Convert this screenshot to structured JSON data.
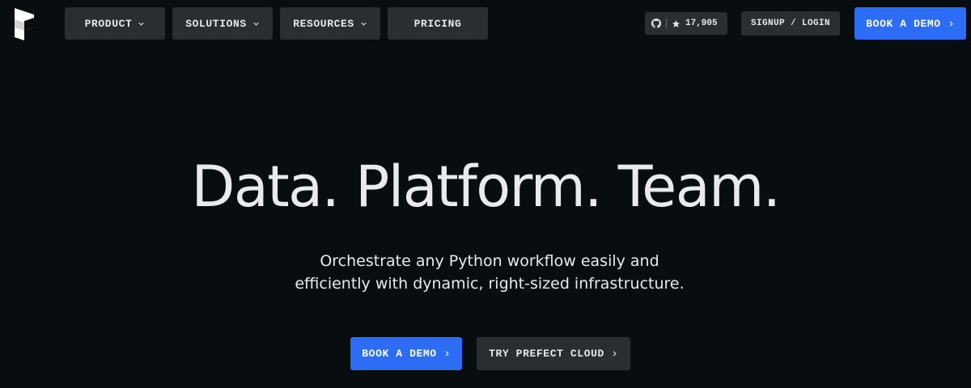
{
  "header": {
    "logo_icon": "prefect-logo-icon",
    "nav": [
      {
        "label": "PRODUCT",
        "has_dropdown": true
      },
      {
        "label": "SOLUTIONS",
        "has_dropdown": true
      },
      {
        "label": "RESOURCES",
        "has_dropdown": true
      },
      {
        "label": "PRICING",
        "has_dropdown": false
      }
    ],
    "github": {
      "icon": "github-icon",
      "star_icon": "star-icon",
      "stars": "17,905"
    },
    "signup_label": "SIGNUP / LOGIN",
    "book_demo_label": "BOOK A DEMO"
  },
  "hero": {
    "title": "Data. Platform. Team.",
    "subtitle_line1": "Orchestrate any Python workflow easily and",
    "subtitle_line2": "efficiently with dynamic, right-sized infrastructure.",
    "cta_primary": "BOOK A DEMO",
    "cta_secondary": "TRY PREFECT CLOUD"
  },
  "colors": {
    "background": "#080d10",
    "button_dark": "#2a2e33",
    "accent_blue": "#2d6df6",
    "text": "#e8eaec"
  }
}
